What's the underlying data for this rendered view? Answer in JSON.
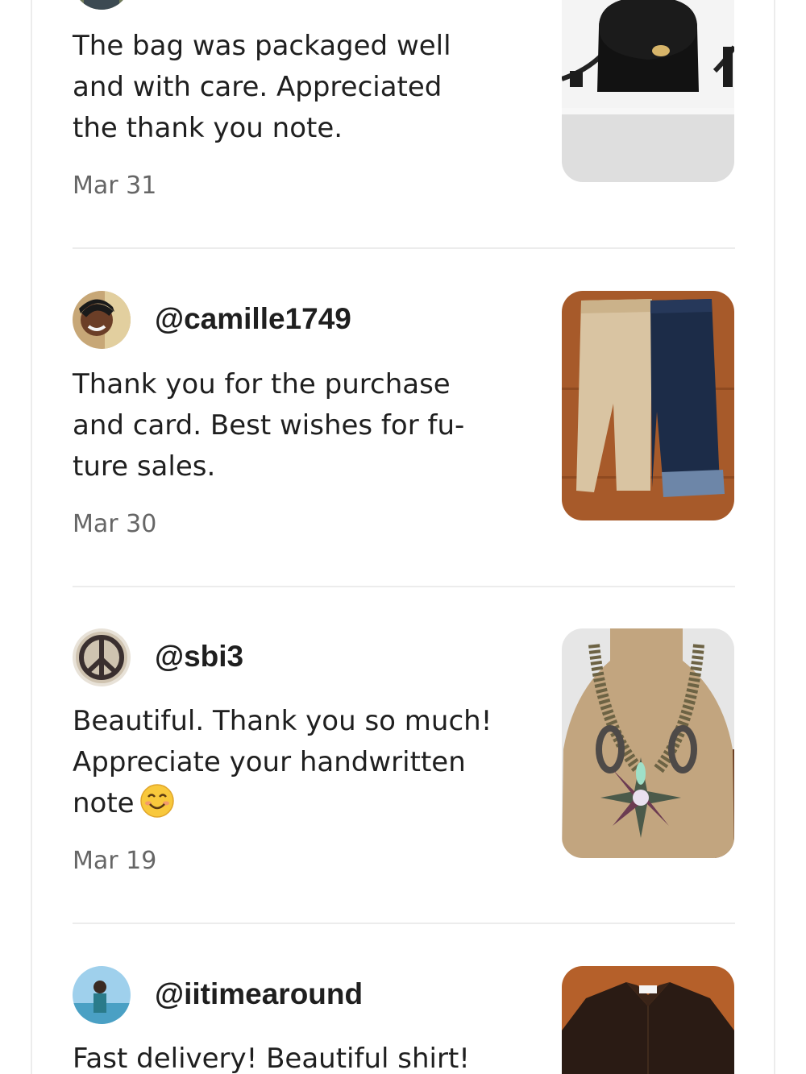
{
  "reviews": [
    {
      "username": "",
      "lines": [
        "The bag was packaged well",
        "and with care. Appreciated",
        "the thank you note."
      ],
      "date": "Mar 31",
      "item_image": "black-crossbody-bag-photo"
    },
    {
      "username": "@camille1749",
      "lines": [
        "Thank you for the purchase",
        "and card. Best wishes for fu-",
        "ture sales."
      ],
      "date": "Mar 30",
      "item_image": "khaki-and-denim-capri-pants-photo"
    },
    {
      "username": "@sbi3",
      "lines": [
        "Beautiful. Thank you so much!",
        "Appreciate your handwritten",
        "note"
      ],
      "emoji": "smiling-face-emoji",
      "date": "Mar 19",
      "item_image": "statement-necklace-on-bust-photo"
    },
    {
      "username": "@iitimearound",
      "lines": [
        "Fast delivery! Beautiful shirt!"
      ],
      "date": "",
      "item_image": "dark-patterned-shirt-photo"
    }
  ],
  "colors": {
    "text": "#1f1f1f",
    "muted": "#666666",
    "divider": "#ececec"
  }
}
